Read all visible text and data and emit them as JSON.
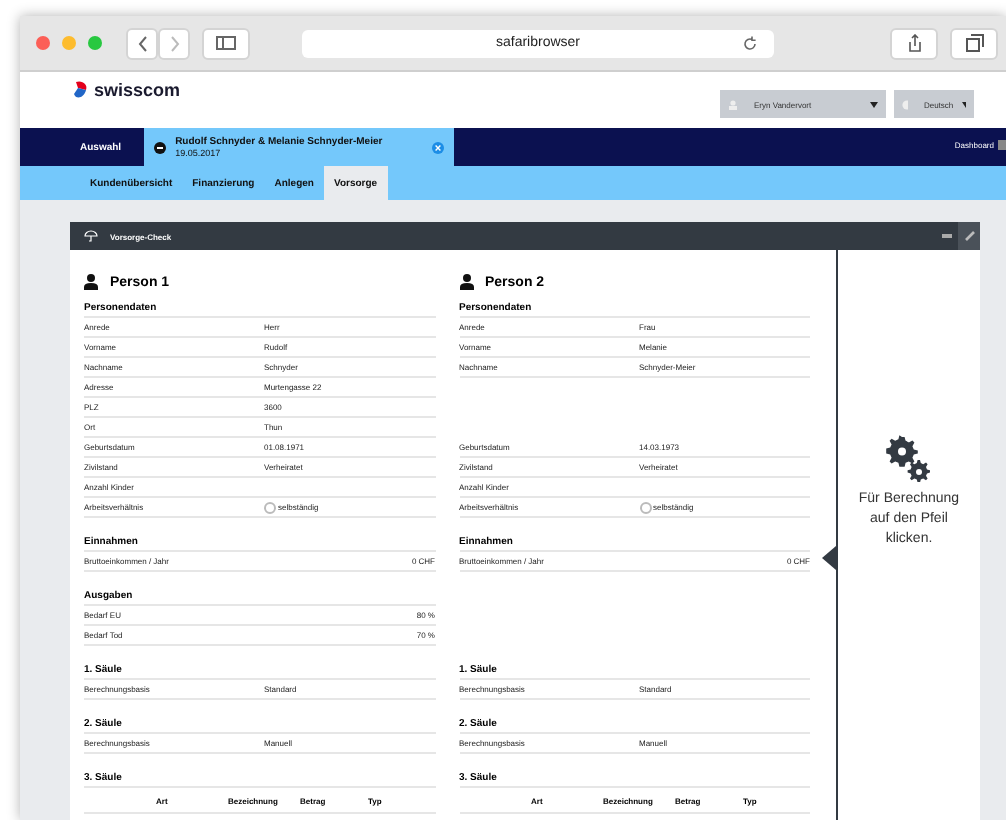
{
  "browser": {
    "address": "safaribrowser"
  },
  "header": {
    "logo": "swisscom",
    "user": "Eryn Vandervort",
    "language": "Deutsch"
  },
  "nav": {
    "selection_label": "Auswahl",
    "client_tab": {
      "names": "Rudolf Schnyder & Melanie Schnyder-Meier",
      "date": "19.05.2017"
    },
    "dashboard": "Dashboard"
  },
  "tabs": [
    {
      "label": "Kundenübersicht",
      "selected": false
    },
    {
      "label": "Finanzierung",
      "selected": false
    },
    {
      "label": "Anlegen",
      "selected": false
    },
    {
      "label": "Vorsorge",
      "selected": true
    }
  ],
  "card": {
    "title": "Vorsorge-Check",
    "hint": "Für Berechnung auf den Pfeil klicken.",
    "persons": [
      {
        "name": "Person 1",
        "items": [
          {
            "kind": "heading",
            "text": "Personendaten"
          },
          {
            "kind": "row",
            "label": "Anrede",
            "value": "Herr"
          },
          {
            "kind": "row",
            "label": "Vorname",
            "value": "Rudolf"
          },
          {
            "kind": "row",
            "label": "Nachname",
            "value": "Schnyder"
          },
          {
            "kind": "row",
            "label": "Adresse",
            "value": "Murtengasse 22"
          },
          {
            "kind": "row",
            "label": "PLZ",
            "value": "3600"
          },
          {
            "kind": "row",
            "label": "Ort",
            "value": "Thun"
          },
          {
            "kind": "row",
            "label": "Geburtsdatum",
            "value": "01.08.1971"
          },
          {
            "kind": "row",
            "label": "Zivilstand",
            "value": "Verheiratet"
          },
          {
            "kind": "row",
            "label": "Anzahl Kinder"
          },
          {
            "kind": "radio",
            "label": "Arbeitsverhältnis",
            "option": "selbständig",
            "checked": false
          },
          {
            "kind": "heading",
            "text": "Einnahmen"
          },
          {
            "kind": "amount",
            "label": "Bruttoeinkommen / Jahr",
            "value": "0 CHF"
          },
          {
            "kind": "heading",
            "text": "Ausgaben"
          },
          {
            "kind": "amount",
            "label": "Bedarf EU",
            "value": "80 %"
          },
          {
            "kind": "amount",
            "label": "Bedarf Tod",
            "value": "70 %"
          },
          {
            "kind": "heading",
            "text": "1. Säule"
          },
          {
            "kind": "row",
            "label": "Berechnungsbasis",
            "value": "Standard"
          },
          {
            "kind": "heading",
            "text": "2. Säule"
          },
          {
            "kind": "row",
            "label": "Berechnungsbasis",
            "value": "Manuell"
          },
          {
            "kind": "heading",
            "text": "3. Säule"
          },
          {
            "kind": "table_header",
            "columns": [
              "Art",
              "Bezeichnung",
              "Betrag",
              "Typ"
            ]
          }
        ]
      },
      {
        "name": "Person 2",
        "items": [
          {
            "kind": "heading",
            "text": "Personendaten"
          },
          {
            "kind": "row",
            "label": "Anrede",
            "value": "Frau"
          },
          {
            "kind": "row",
            "label": "Vorname",
            "value": "Melanie"
          },
          {
            "kind": "row",
            "label": "Nachname",
            "value": "Schnyder-Meier"
          },
          {
            "kind": "blank_row"
          },
          {
            "kind": "blank_row"
          },
          {
            "kind": "blank_row"
          },
          {
            "kind": "row",
            "label": "Geburtsdatum",
            "value": "14.03.1973"
          },
          {
            "kind": "row",
            "label": "Zivilstand",
            "value": "Verheiratet"
          },
          {
            "kind": "row",
            "label": "Anzahl Kinder"
          },
          {
            "kind": "radio",
            "label": "Arbeitsverhältnis",
            "option": "selbständig",
            "checked": false
          },
          {
            "kind": "heading",
            "text": "Einnahmen"
          },
          {
            "kind": "amount",
            "label": "Bruttoeinkommen / Jahr",
            "value": "0 CHF"
          },
          {
            "kind": "blank_heading"
          },
          {
            "kind": "blank_row"
          },
          {
            "kind": "blank_row"
          },
          {
            "kind": "heading",
            "text": "1. Säule"
          },
          {
            "kind": "row",
            "label": "Berechnungsbasis",
            "value": "Standard"
          },
          {
            "kind": "heading",
            "text": "2. Säule"
          },
          {
            "kind": "row",
            "label": "Berechnungsbasis",
            "value": "Manuell"
          },
          {
            "kind": "heading",
            "text": "3. Säule"
          },
          {
            "kind": "table_header",
            "columns": [
              "Art",
              "Bezeichnung",
              "Betrag",
              "Typ"
            ]
          }
        ]
      }
    ]
  }
}
